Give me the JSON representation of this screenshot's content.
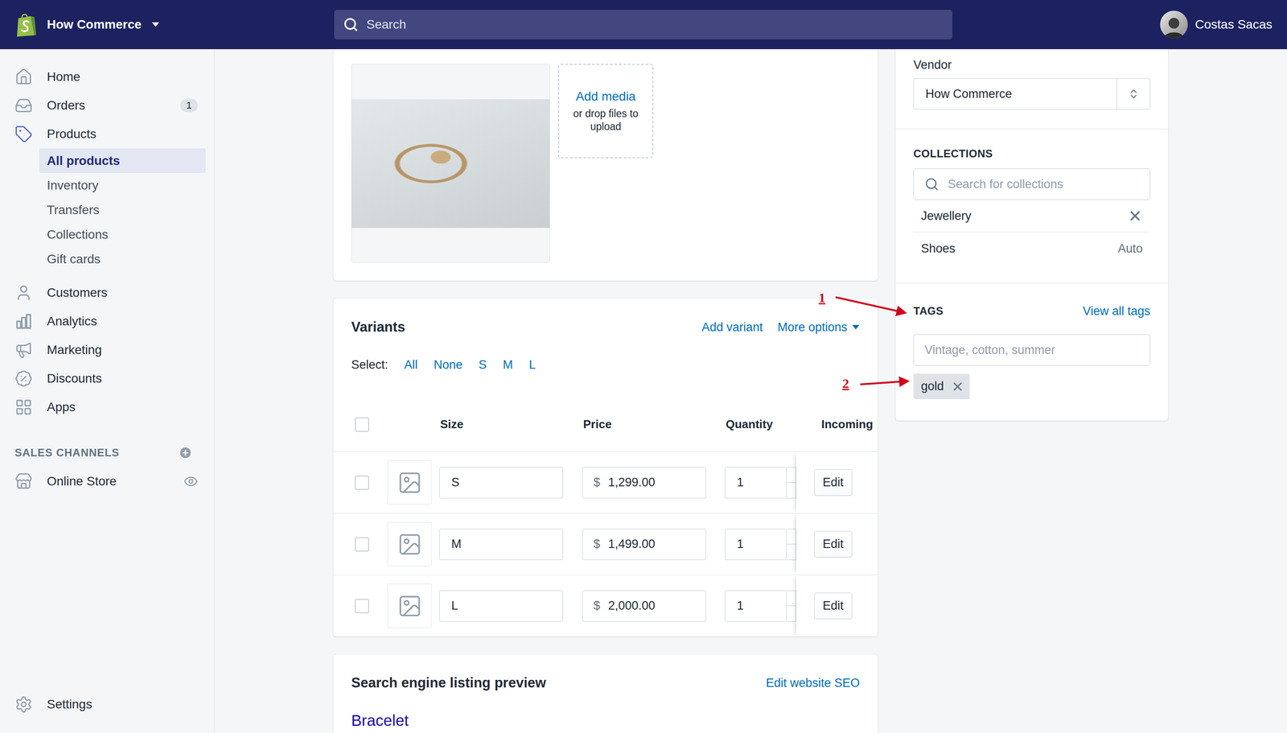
{
  "store": {
    "name": "How Commerce"
  },
  "search": {
    "placeholder": "Search"
  },
  "user": {
    "name": "Costas Sacas"
  },
  "sidebar": {
    "items": [
      {
        "label": "Home",
        "selected": false
      },
      {
        "label": "Orders",
        "badge": "1",
        "selected": false
      },
      {
        "label": "Products",
        "selected": true,
        "expanded": true,
        "children": [
          {
            "label": "All products",
            "selected": true
          },
          {
            "label": "Inventory",
            "selected": false
          },
          {
            "label": "Transfers",
            "selected": false
          },
          {
            "label": "Collections",
            "selected": false
          },
          {
            "label": "Gift cards",
            "selected": false
          }
        ]
      },
      {
        "label": "Customers",
        "selected": false
      },
      {
        "label": "Analytics",
        "selected": false
      },
      {
        "label": "Marketing",
        "selected": false
      },
      {
        "label": "Discounts",
        "selected": false
      },
      {
        "label": "Apps",
        "selected": false
      }
    ],
    "sales_channels": {
      "title": "SALES CHANNELS",
      "items": [
        {
          "label": "Online Store"
        }
      ]
    },
    "settings": {
      "label": "Settings"
    }
  },
  "media": {
    "add_label": "Add media",
    "hint": "or drop files to upload"
  },
  "variants": {
    "title": "Variants",
    "actions": [
      {
        "label": "Add variant",
        "kind": "link"
      },
      {
        "label": "More options",
        "kind": "menu"
      }
    ],
    "select_label": "Select:",
    "select_options": [
      "All",
      "None",
      "S",
      "M",
      "L"
    ],
    "header_checked": false,
    "columns": [
      "Size",
      "Price",
      "Quantity",
      "Incoming"
    ],
    "rows": [
      {
        "size": "S",
        "currency": "$",
        "price": "1,299.00",
        "quantity": "1",
        "action": "Edit",
        "checked": false
      },
      {
        "size": "M",
        "currency": "$",
        "price": "1,499.00",
        "quantity": "1",
        "action": "Edit",
        "checked": false
      },
      {
        "size": "L",
        "currency": "$",
        "price": "2,000.00",
        "quantity": "1",
        "action": "Edit",
        "checked": false
      }
    ]
  },
  "seo": {
    "title": "Search engine listing preview",
    "action": "Edit website SEO",
    "preview_title": "Bracelet"
  },
  "organization": {
    "vendor": {
      "label": "Vendor",
      "value": "How Commerce"
    },
    "collections": {
      "label": "COLLECTIONS",
      "placeholder": "Search for collections",
      "items": [
        {
          "name": "Jewellery",
          "kind": "removable"
        },
        {
          "name": "Shoes",
          "kind": "auto",
          "note": "Auto"
        }
      ]
    },
    "tags": {
      "label": "TAGS",
      "action": "View all tags",
      "placeholder": "Vintage, cotton, summer",
      "items": [
        {
          "label": "gold"
        }
      ]
    }
  },
  "annotations": [
    {
      "label": "1"
    },
    {
      "label": "2"
    }
  ]
}
